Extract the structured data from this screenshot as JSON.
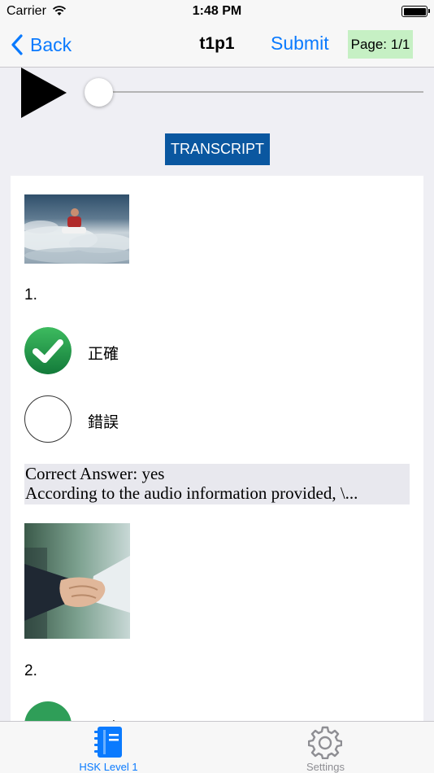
{
  "status_bar": {
    "carrier": "Carrier",
    "time": "1:48 PM"
  },
  "nav": {
    "back_label": "Back",
    "title": "t1p1",
    "submit_label": "Submit",
    "page_label": "Page: 1/1"
  },
  "player": {
    "progress": 0
  },
  "transcript_label": "TRANSCRIPT",
  "questions": [
    {
      "number": "1.",
      "options": [
        {
          "label": "正確",
          "state": "selected-correct"
        },
        {
          "label": "錯誤",
          "state": "unselected"
        }
      ],
      "answer_line1": "Correct Answer: yes",
      "answer_line2": "According to the audio information provided, \\..."
    },
    {
      "number": "2.",
      "options": [
        {
          "label": "正確",
          "state": "selected"
        }
      ]
    }
  ],
  "tabs": [
    {
      "label": "HSK Level 1",
      "icon": "notebook-icon",
      "active": true
    },
    {
      "label": "Settings",
      "icon": "gear-icon",
      "active": false
    }
  ],
  "colors": {
    "accent": "#0a7afe",
    "transcript_bg": "#0a57a0",
    "page_badge_bg": "#c6f0c4",
    "correct_green": "#1e9a48"
  }
}
